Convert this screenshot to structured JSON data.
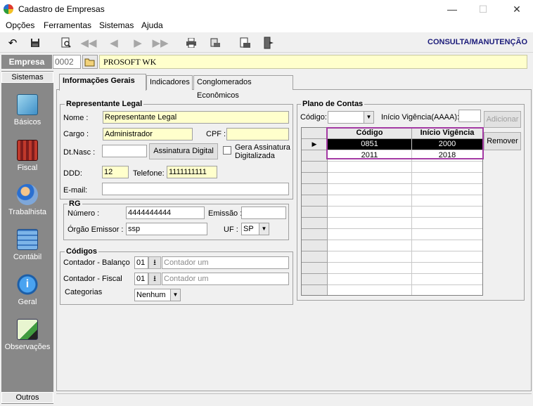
{
  "window": {
    "title": "Cadastro de Empresas",
    "minimize": "—",
    "maximize": "☐",
    "close": "✕"
  },
  "menu": [
    "Opções",
    "Ferramentas",
    "Sistemas",
    "Ajuda"
  ],
  "toolbar": {
    "mode_label": "CONSULTA/MANUTENÇÃO"
  },
  "empresa": {
    "label": "Empresa",
    "code": "0002",
    "name": "PROSOFT WK"
  },
  "sidebar": {
    "header": "Sistemas",
    "footer": "Outros",
    "items": [
      "Básicos",
      "Fiscal",
      "Trabalhista",
      "Contábil",
      "Geral",
      "Observações"
    ]
  },
  "tabs": [
    "Informações Gerais",
    "Indicadores",
    "Conglomerados Econômicos"
  ],
  "representante": {
    "title": "Representante Legal",
    "nome_label": "Nome :",
    "nome": "Representante Legal",
    "cargo_label": "Cargo :",
    "cargo": "Administrador",
    "cpf_label": "CPF :",
    "cpf": "",
    "dtnasc_label": "Dt.Nasc :",
    "dtnasc": "",
    "assinatura_button": "Assinatura Digital",
    "gera_assinatura": "Gera Assinatura Digitalizada",
    "ddd_label": "DDD:",
    "ddd": "12",
    "telefone_label": "Telefone:",
    "telefone": "1111111111",
    "email_label": "E-mail:",
    "email": ""
  },
  "rg": {
    "title": "RG",
    "numero_label": "Número :",
    "numero": "4444444444",
    "emissao_label": "Emissão :",
    "emissao": "",
    "orgao_label": "Órgão Emissor :",
    "orgao": "ssp",
    "uf_label": "UF :",
    "uf": "SP"
  },
  "codigos": {
    "title": "Códigos",
    "balanco_label": "Contador - Balanço",
    "balanco_code": "01",
    "balanco_placeholder": "Contador um",
    "fiscal_label": "Contador - Fiscal",
    "fiscal_code": "01",
    "fiscal_placeholder": "Contador um",
    "categorias_label": "Categorias",
    "categorias": "Nenhum"
  },
  "plano": {
    "title": "Plano de Contas",
    "codigo_label": "Código:",
    "codigo": "",
    "inicio_label": "Início Vigência(AAAA):",
    "inicio": "",
    "adicionar": "Adicionar",
    "remover": "Remover",
    "columns": [
      "Código",
      "Início Vigência"
    ],
    "rows": [
      {
        "codigo": "0851",
        "inicio": "2000"
      },
      {
        "codigo": "2011",
        "inicio": "2018"
      }
    ]
  },
  "colors": {
    "accent_purple": "#a43aa4",
    "yellow_field": "#ffffcc",
    "sidebar": "#888888",
    "mode_label": "#1c1c7a"
  }
}
